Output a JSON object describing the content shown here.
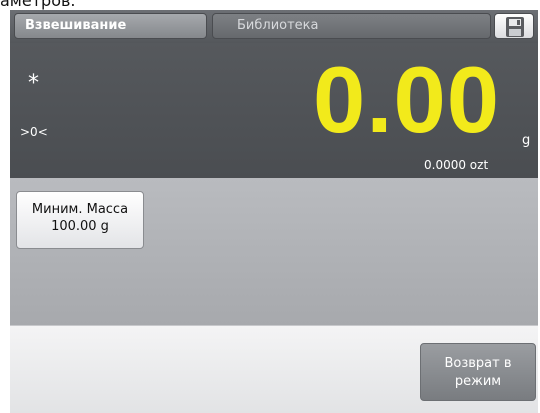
{
  "top_text": "аметров.",
  "tabs": {
    "active": "Взвешивание",
    "library": "Библиотека"
  },
  "icons": {
    "save": "floppy-disk-icon"
  },
  "display": {
    "stable_indicator": "*",
    "zero_indicator": ">0<",
    "weight": "0.00",
    "unit": "g",
    "secondary_reading": "0.0000 ozt"
  },
  "min_mass": {
    "line1": "Миним. Масса",
    "line2": "100.00 g"
  },
  "footer": {
    "back_line1": "Возврат в",
    "back_line2": "режим"
  },
  "colors": {
    "weight": "#f2ea1b",
    "display_bg": "#4f5256",
    "work_bg": "#b0b2b6"
  }
}
